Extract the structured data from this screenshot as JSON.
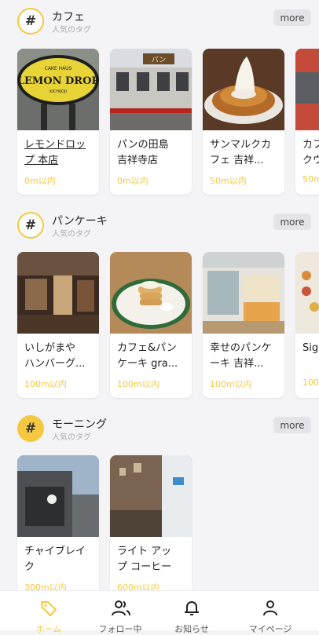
{
  "sections": [
    {
      "title": "カフェ",
      "subtitle": "人気のタグ",
      "more": "more",
      "cards": [
        {
          "title": "レモンドロッ\nプ 本店",
          "distance": "0m以内",
          "image": "lemon-drop-storefront"
        },
        {
          "title": "パンの田島\n吉祥寺店",
          "distance": "0m以内",
          "image": "bakery-storefront"
        },
        {
          "title": "サンマルクカ\nフェ 吉祥...",
          "distance": "50m以内",
          "image": "soft-serve-dessert"
        },
        {
          "title": "カフ\nクウ",
          "distance": "50m",
          "image": "cafe-exterior"
        }
      ]
    },
    {
      "title": "パンケーキ",
      "subtitle": "人気のタグ",
      "more": "more",
      "cards": [
        {
          "title": "いしがまや\nハンバーグ...",
          "distance": "100m以内",
          "image": "restaurant-interior"
        },
        {
          "title": "カフェ&パン\nケーキ gra...",
          "distance": "100m以内",
          "image": "pancake-plate"
        },
        {
          "title": "幸せのパンケ\nーキ 吉祥...",
          "distance": "100m以内",
          "image": "pancake-shop-interior"
        },
        {
          "title": "Sig",
          "distance": "100",
          "image": "sign-display"
        }
      ]
    },
    {
      "title": "モーニング",
      "subtitle": "人気のタグ",
      "more": "more",
      "cards": [
        {
          "title": "チャイブレイ\nク",
          "distance": "300m以内",
          "image": "building-exterior"
        },
        {
          "title": "ライト アッ\nプ コーヒー",
          "distance": "600m以内",
          "image": "coffee-shop-interior"
        }
      ]
    }
  ],
  "tabbar": {
    "tabs": [
      {
        "label": "ホーム",
        "icon": "tag-icon",
        "active": true
      },
      {
        "label": "フォロー中",
        "icon": "users-icon"
      },
      {
        "label": "お知らせ",
        "icon": "bell-icon"
      },
      {
        "label": "マイページ",
        "icon": "person-icon"
      }
    ]
  },
  "colors": {
    "accent": "#f5c842",
    "background": "#f4f4f6"
  }
}
